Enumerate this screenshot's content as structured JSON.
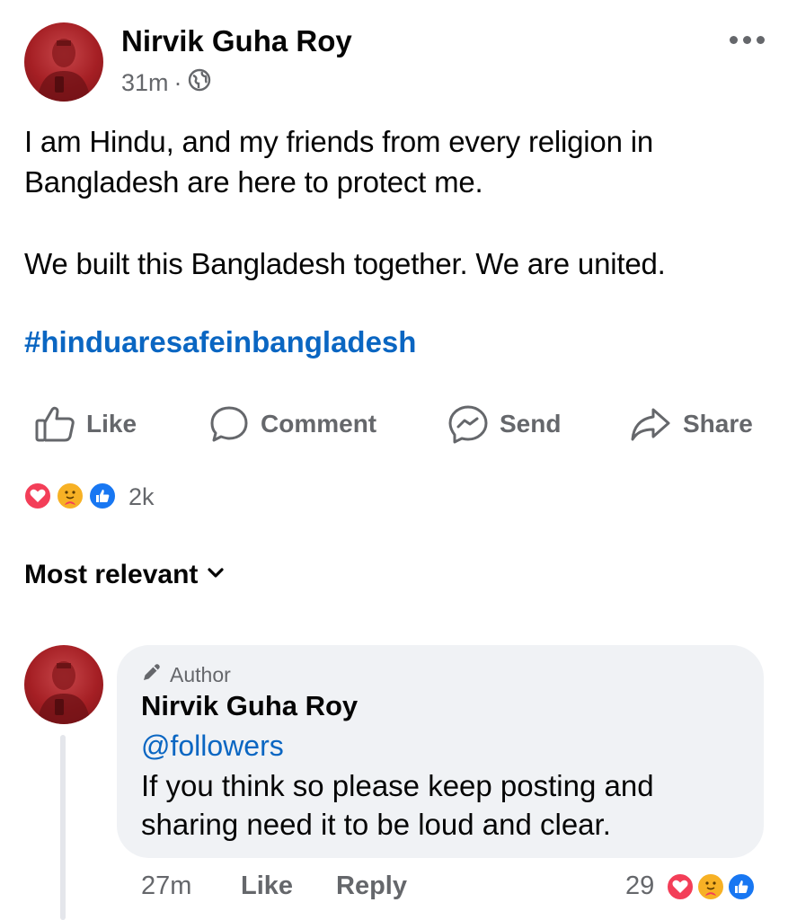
{
  "post": {
    "author": "Nirvik Guha Roy",
    "time": "31m",
    "separator": "·",
    "privacy_icon": "globe-icon",
    "text_line1": "I am Hindu, and my friends from every religion in",
    "text_line2": "Bangladesh are here to protect me.",
    "text_line3": "We built this Bangladesh together. We are united.",
    "hashtag": "#hinduaresafeinbangladesh"
  },
  "actions": {
    "like": "Like",
    "comment": "Comment",
    "send": "Send",
    "share": "Share"
  },
  "reactions": {
    "icons": [
      "heart-reaction-icon",
      "care-reaction-icon",
      "like-reaction-icon"
    ],
    "count": "2k"
  },
  "sort": {
    "label": "Most relevant"
  },
  "comment": {
    "badge": "Author",
    "author": "Nirvik Guha Roy",
    "mention": "@followers",
    "text_line1": "If you think so please keep posting and",
    "text_line2": "sharing need it to be loud and clear.",
    "time": "27m",
    "like": "Like",
    "reply": "Reply",
    "reaction_count": "29"
  },
  "colors": {
    "link": "#0a66c2",
    "muted": "#65676b",
    "bubble": "#f0f2f5",
    "like_blue": "#1877f2",
    "heart_red": "#f33e58"
  }
}
